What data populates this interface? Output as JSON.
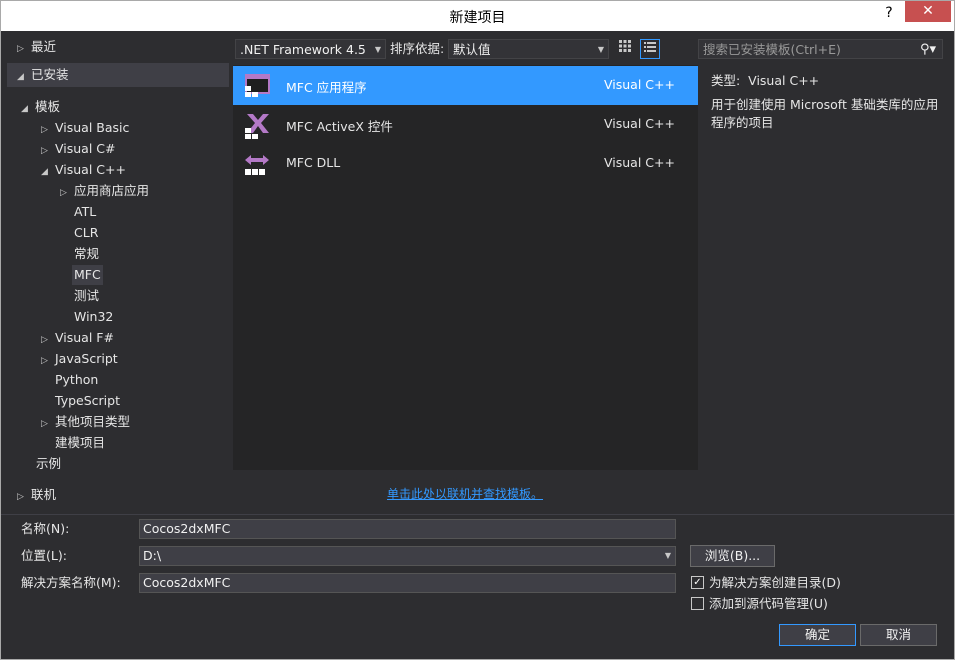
{
  "window": {
    "title": "新建项目",
    "help": "?",
    "close": "✕"
  },
  "tree": {
    "recent": "最近",
    "installed": "已安装",
    "templates": "模板",
    "vb": "Visual Basic",
    "csharp": "Visual C#",
    "cpp": "Visual C++",
    "store": "应用商店应用",
    "atl": "ATL",
    "clr": "CLR",
    "general": "常规",
    "mfc": "MFC",
    "test": "测试",
    "win32": "Win32",
    "fsharp": "Visual F#",
    "javascript": "JavaScript",
    "python": "Python",
    "typescript": "TypeScript",
    "other": "其他项目类型",
    "build": "建模项目",
    "samples": "示例",
    "online": "联机"
  },
  "toolbar": {
    "framework": ".NET Framework 4.5",
    "sort_label": "排序依据:",
    "sort_value": "默认值",
    "search_placeholder": "搜索已安装模板(Ctrl+E)"
  },
  "templates": [
    {
      "name": "MFC 应用程序",
      "lang": "Visual C++",
      "selected": true
    },
    {
      "name": "MFC ActiveX 控件",
      "lang": "Visual C++",
      "selected": false
    },
    {
      "name": "MFC DLL",
      "lang": "Visual C++",
      "selected": false
    }
  ],
  "info": {
    "type_label": "类型:",
    "type_value": "Visual C++",
    "description": "用于创建使用 Microsoft 基础类库的应用程序的项目"
  },
  "online_link": "单击此处以联机并查找模板。",
  "form": {
    "name_label": "名称(N):",
    "name_value": "Cocos2dxMFC",
    "location_label": "位置(L):",
    "location_value": "D:\\",
    "solution_label": "解决方案名称(M):",
    "solution_value": "Cocos2dxMFC",
    "browse": "浏览(B)...",
    "create_dir": "为解决方案创建目录(D)",
    "create_dir_checked": true,
    "add_scm": "添加到源代码管理(U)",
    "add_scm_checked": false,
    "ok": "确定",
    "cancel": "取消"
  },
  "colors": {
    "accent": "#3399ff",
    "background": "#2d2d30",
    "list_bg": "#252526",
    "close": "#c75050",
    "icon_purple": "#b479c7"
  }
}
